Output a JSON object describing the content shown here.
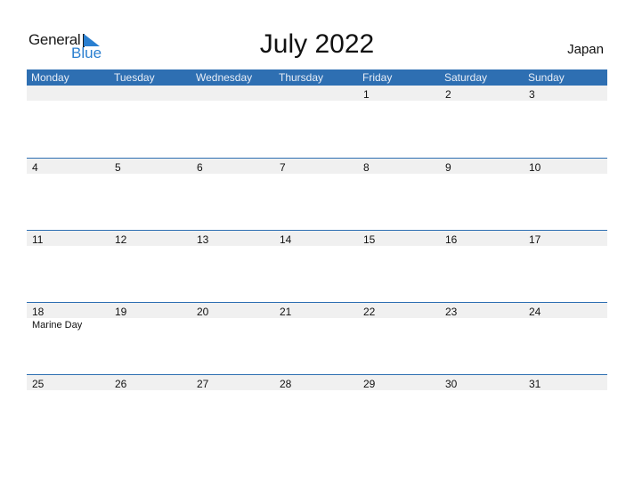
{
  "logo": {
    "text1": "General",
    "text2": "Blue"
  },
  "title": "July 2022",
  "country": "Japan",
  "days": [
    "Monday",
    "Tuesday",
    "Wednesday",
    "Thursday",
    "Friday",
    "Saturday",
    "Sunday"
  ],
  "weeks": [
    {
      "dates": [
        "",
        "",
        "",
        "",
        "1",
        "2",
        "3"
      ],
      "holidays": [
        "",
        "",
        "",
        "",
        "",
        "",
        ""
      ]
    },
    {
      "dates": [
        "4",
        "5",
        "6",
        "7",
        "8",
        "9",
        "10"
      ],
      "holidays": [
        "",
        "",
        "",
        "",
        "",
        "",
        ""
      ]
    },
    {
      "dates": [
        "11",
        "12",
        "13",
        "14",
        "15",
        "16",
        "17"
      ],
      "holidays": [
        "",
        "",
        "",
        "",
        "",
        "",
        ""
      ]
    },
    {
      "dates": [
        "18",
        "19",
        "20",
        "21",
        "22",
        "23",
        "24"
      ],
      "holidays": [
        "Marine Day",
        "",
        "",
        "",
        "",
        "",
        ""
      ]
    },
    {
      "dates": [
        "25",
        "26",
        "27",
        "28",
        "29",
        "30",
        "31"
      ],
      "holidays": [
        "",
        "",
        "",
        "",
        "",
        "",
        ""
      ]
    }
  ],
  "colors": {
    "accent": "#2e6fb2",
    "band": "#f0f0f0"
  }
}
